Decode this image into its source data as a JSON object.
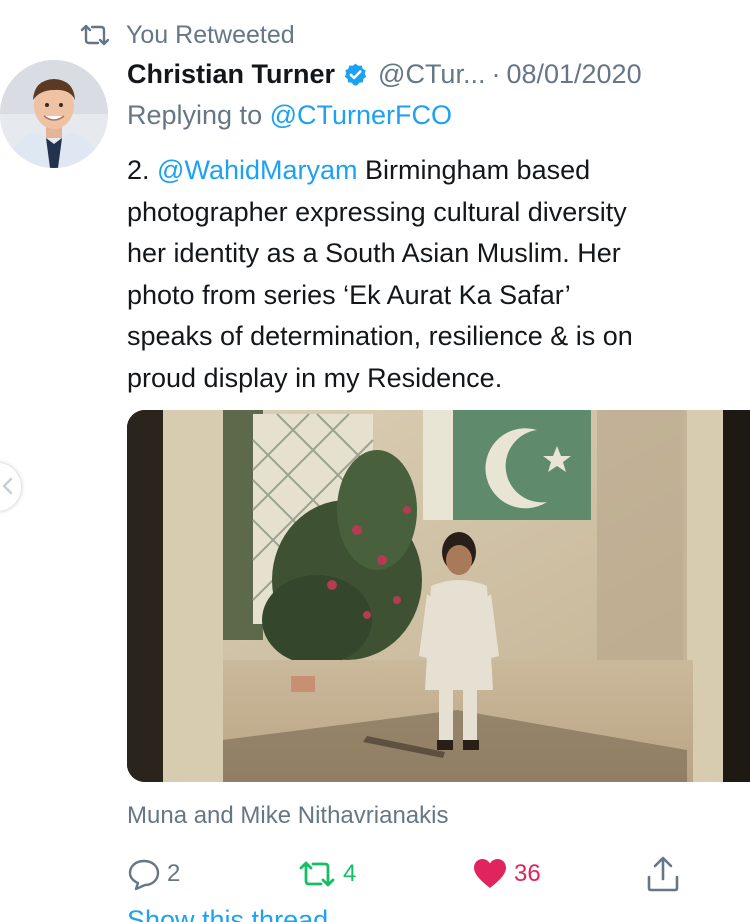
{
  "retweet_context": {
    "icon": "retweet-icon",
    "label": "You Retweeted"
  },
  "tweet": {
    "author": {
      "display_name": "Christian Turner",
      "handle": "@CTur...",
      "verified": true
    },
    "separator": "·",
    "date": "08/01/2020",
    "reply_to": {
      "prefix": "Replying to",
      "handle": "@CTurnerFCO"
    },
    "text": {
      "line1_number": "2.",
      "line1_mention": "@WahidMaryam",
      "line1_rest": "Birmingham based",
      "line2": "photographer expressing cultural diversity",
      "line3": "her identity as a South Asian Muslim. Her",
      "line4": "photo from series ‘Ek Aurat Ka Safar’",
      "line5": "speaks of determination, resilience & is on",
      "line6": "proud display in my Residence."
    },
    "media_caption": "Muna and Mike Nithavrianakis",
    "actions": {
      "reply": {
        "icon": "reply-icon",
        "count": "2"
      },
      "retweet": {
        "icon": "retweet-icon",
        "count": "4",
        "active": true,
        "color": "#17bf63"
      },
      "like": {
        "icon": "heart-icon",
        "count": "36",
        "active": true,
        "color": "#e0245e"
      },
      "share": {
        "icon": "share-icon"
      }
    },
    "show_thread": "Show this thread"
  },
  "colors": {
    "accent": "#1da1f2",
    "secondary_text": "#657786",
    "primary_text": "#14171a"
  }
}
